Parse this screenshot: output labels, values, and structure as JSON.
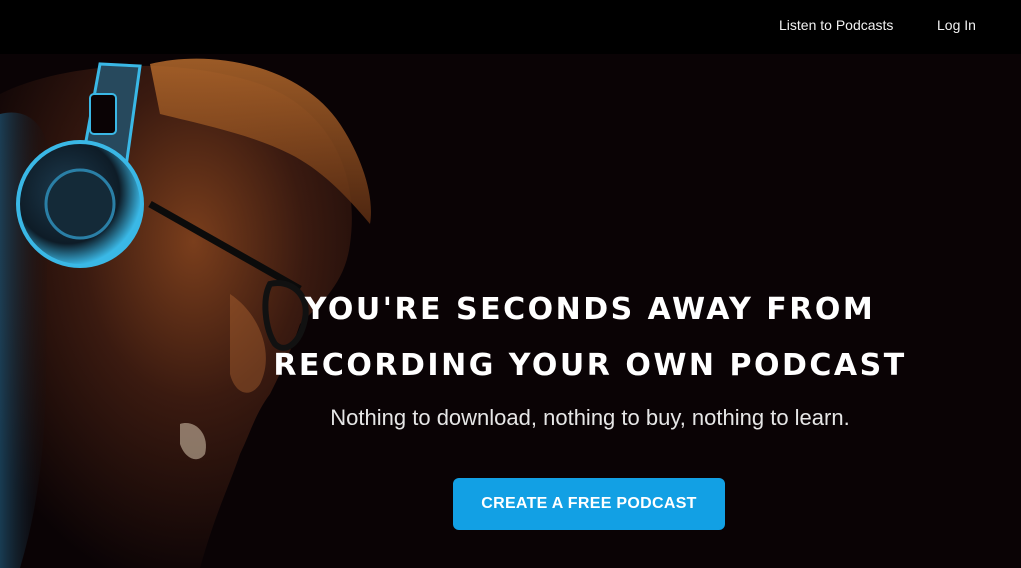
{
  "nav": {
    "listen_label": "Listen to Podcasts",
    "login_label": "Log In"
  },
  "hero": {
    "headline_line1": "YOU'RE SECONDS AWAY FROM",
    "headline_line2": "RECORDING YOUR OWN PODCAST",
    "subheadline": "Nothing to download, nothing to buy, nothing to learn.",
    "cta_label": "CREATE A FREE PODCAST"
  },
  "colors": {
    "background": "#0a0305",
    "topbar": "#000000",
    "accent": "#12a0e4",
    "text": "#ffffff",
    "headphone_highlight": "#3ab8e6",
    "skin_warm": "#c8763a"
  },
  "icons": {
    "hero_image": "man-with-headphones-photo"
  }
}
